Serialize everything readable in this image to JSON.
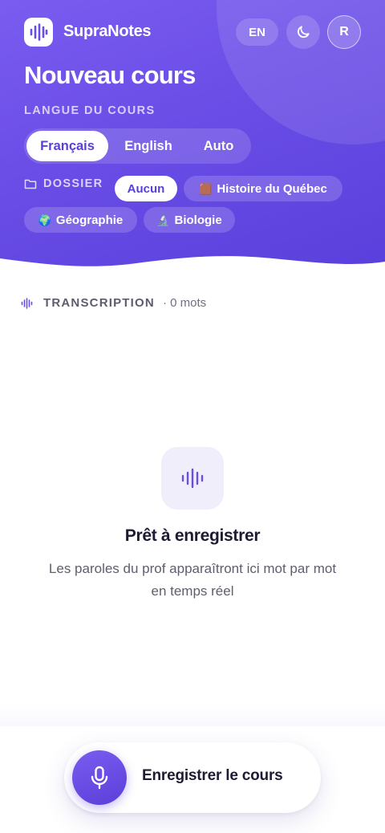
{
  "brand": {
    "name": "SupraNotes",
    "logo_icon": "waveform-icon"
  },
  "header": {
    "lang_toggle": "EN",
    "theme_icon": "moon-icon",
    "avatar_initial": "R",
    "title": "Nouveau cours"
  },
  "course_language": {
    "label": "LANGUE DU COURS",
    "options": [
      "Français",
      "English",
      "Auto"
    ],
    "selected": "Français"
  },
  "folder": {
    "icon": "folder-icon",
    "label": "DOSSIER",
    "options": [
      {
        "emoji": "",
        "label": "Aucun"
      },
      {
        "emoji": "🟫",
        "label": "Histoire du Québec"
      },
      {
        "emoji": "🌍",
        "label": "Géographie"
      },
      {
        "emoji": "🔬",
        "label": "Biologie"
      }
    ],
    "selected": "Aucun"
  },
  "transcription": {
    "icon": "waveform-icon",
    "label": "TRANSCRIPTION",
    "count": "· 0 mots"
  },
  "empty_state": {
    "icon": "waveform-icon",
    "title": "Prêt à enregistrer",
    "subtitle": "Les paroles du prof apparaîtront ici mot par mot en temps réel"
  },
  "record": {
    "icon": "microphone-icon",
    "label": "Enregistrer le cours"
  },
  "colors": {
    "primary": "#6a4de6",
    "primary_dark": "#5b3fd8",
    "text_dark": "#1d1b33"
  }
}
